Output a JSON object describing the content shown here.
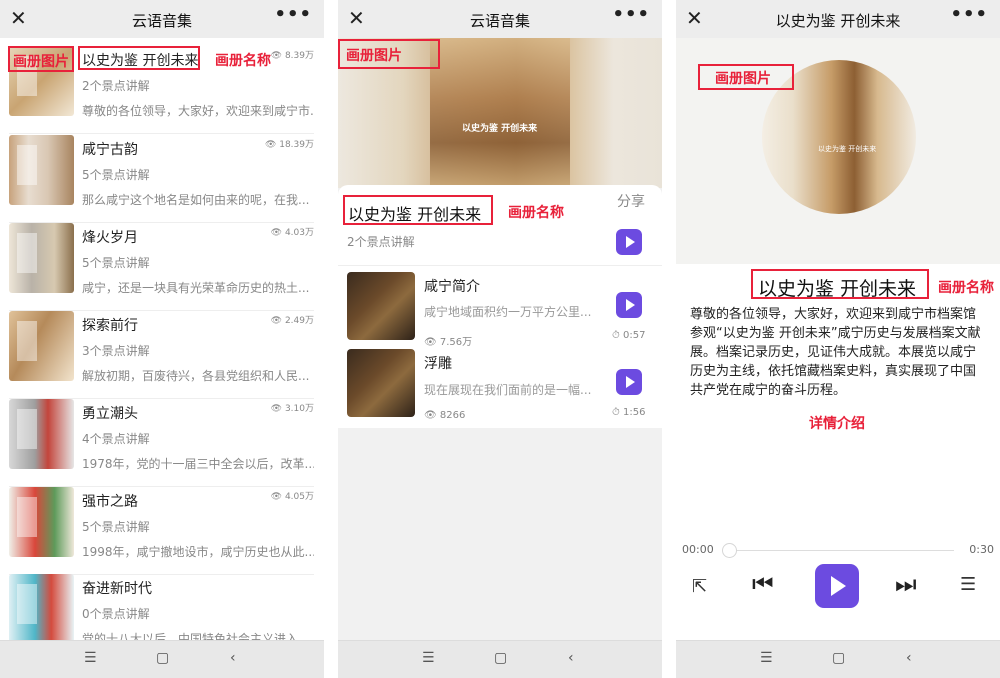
{
  "app": {
    "title": "云语音集",
    "close_icon": "close-icon",
    "more_icon": "more-icon"
  },
  "annotations": {
    "album_image": "画册图片",
    "album_name": "画册名称",
    "detail_intro": "详情介绍",
    "color": "#e8213a"
  },
  "panel1": {
    "albums": [
      {
        "name": "以史为鉴 开创未来",
        "views": "8.39万",
        "count": "2个景点讲解",
        "desc": "尊敬的各位领导，大家好，欢迎来到咸宁市..."
      },
      {
        "name": "咸宁古韵",
        "views": "18.39万",
        "count": "5个景点讲解",
        "desc": "那么咸宁这个地名是如何由来的呢，在我..."
      },
      {
        "name": "烽火岁月",
        "views": "4.03万",
        "count": "5个景点讲解",
        "desc": "咸宁，还是一块具有光荣革命历史的热土..."
      },
      {
        "name": "探索前行",
        "views": "2.49万",
        "count": "3个景点讲解",
        "desc": "解放初期，百废待兴，各县党组织和人民..."
      },
      {
        "name": "勇立潮头",
        "views": "3.10万",
        "count": "4个景点讲解",
        "desc": "1978年，党的十一届三中全会以后，改革..."
      },
      {
        "name": "强市之路",
        "views": "4.05万",
        "count": "5个景点讲解",
        "desc": "1998年，咸宁撤地设市，咸宁历史也从此..."
      },
      {
        "name": "奋进新时代",
        "views": "",
        "count": "0个景点讲解",
        "desc": "党的十八大以后，中国特色社会主义进入..."
      }
    ]
  },
  "panel2": {
    "banner_caption": "以史为鉴 开创未来",
    "album_title": "以史为鉴 开创未来",
    "share": "分享",
    "count": "2个景点讲解",
    "tracks": [
      {
        "name": "咸宁简介",
        "desc": "咸宁地域面积约一万平方公里...",
        "views": "7.56万",
        "duration": "0:57"
      },
      {
        "name": "浮雕",
        "desc": "现在展现在我们面前的是一幅...",
        "views": "8266",
        "duration": "1:56"
      }
    ]
  },
  "panel3": {
    "disc_caption": "以史为鉴 开创未来",
    "album_title": "以史为鉴 开创未来",
    "description": "尊敬的各位领导，大家好，欢迎来到咸宁市档案馆参观“以史为鉴 开创未来”咸宁历史与发展档案文献展。档案记录历史，见证伟大成就。本展览以咸宁历史为主线，依托馆藏档案史料，真实展现了中国共产党在咸宁的奋斗历程。",
    "time_current": "00:00",
    "time_total": "0:30",
    "progress": 0
  },
  "nav": {
    "menu_icon": "menu-icon",
    "home_icon": "home-icon",
    "back_icon": "back-icon"
  },
  "colors": {
    "accent": "#6c4be0",
    "annotation": "#e8213a"
  }
}
